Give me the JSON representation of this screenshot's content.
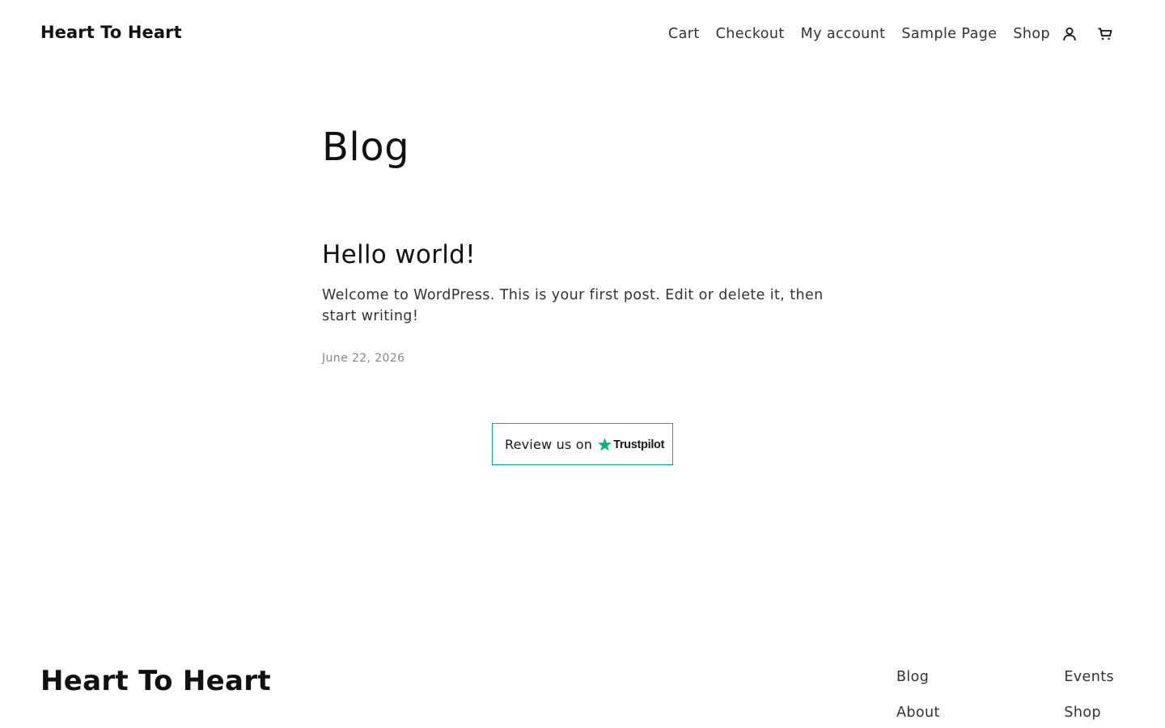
{
  "header": {
    "site_title": "Heart To Heart",
    "nav": [
      {
        "label": "Cart"
      },
      {
        "label": "Checkout"
      },
      {
        "label": "My account"
      },
      {
        "label": "Sample Page"
      },
      {
        "label": "Shop"
      }
    ],
    "icons": {
      "account": "account-icon",
      "cart": "cart-icon"
    }
  },
  "main": {
    "page_title": "Blog",
    "posts": [
      {
        "title": "Hello world!",
        "excerpt": "Welcome to WordPress. This is your first post. Edit or delete it, then start writing!",
        "date": "June 22, 2026"
      }
    ],
    "review": {
      "text": "Review us on",
      "brand": "Trustpilot",
      "border_color": "#00b67a",
      "star_color": "#00b67a"
    }
  },
  "footer": {
    "site_title": "Heart To Heart",
    "col1": [
      {
        "label": "Blog"
      },
      {
        "label": "About"
      }
    ],
    "col2": [
      {
        "label": "Events"
      },
      {
        "label": "Shop"
      }
    ]
  }
}
